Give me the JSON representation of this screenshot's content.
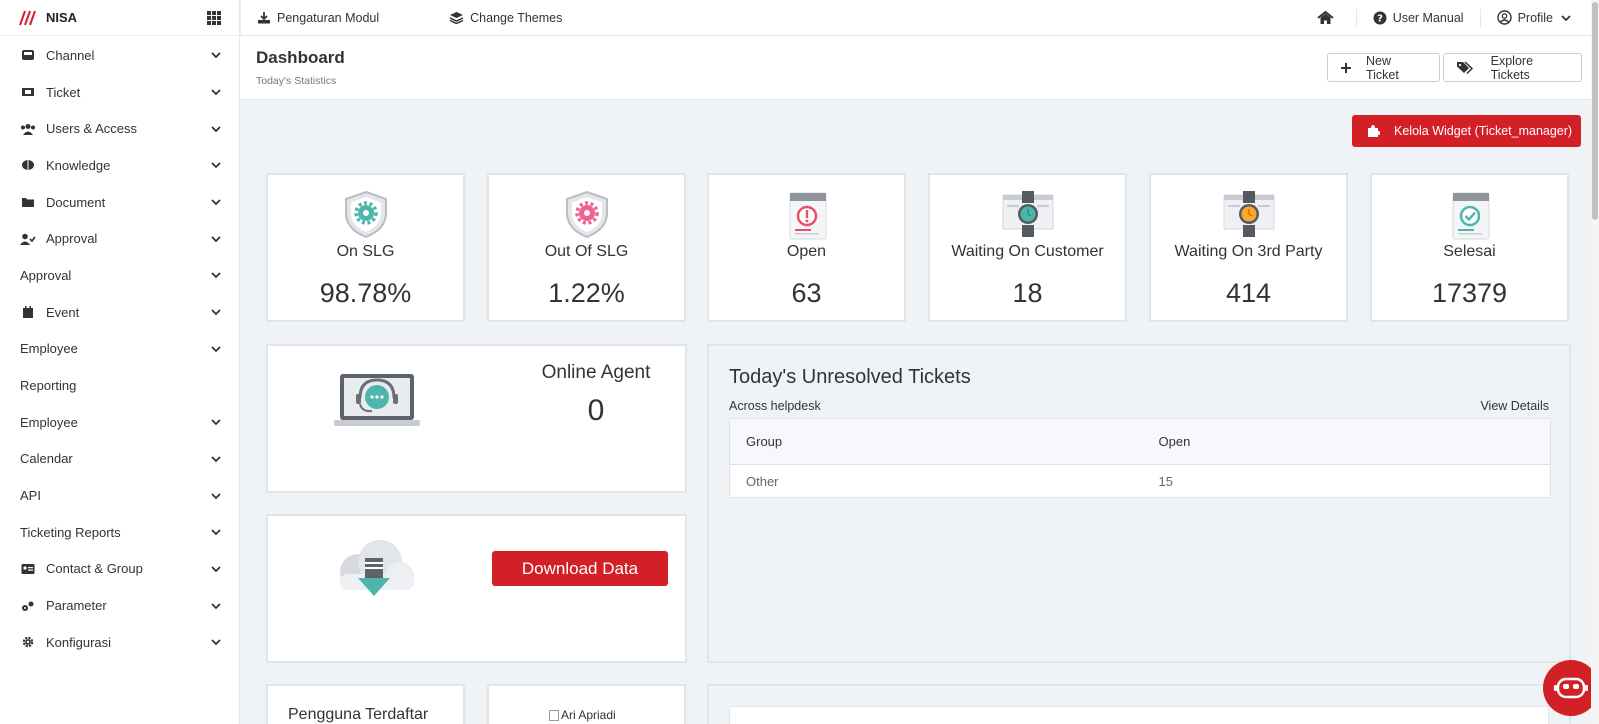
{
  "brand": {
    "name": "NISA",
    "logo": "nisa-logo",
    "apps_icon": "apps-grid-icon"
  },
  "sidebar": {
    "items": [
      {
        "label": "Channel",
        "icon": "channel-icon",
        "chevron": true
      },
      {
        "label": "Ticket",
        "icon": "ticket-icon",
        "chevron": true
      },
      {
        "label": "Users & Access",
        "icon": "users-icon",
        "chevron": true
      },
      {
        "label": "Knowledge",
        "icon": "brain-icon",
        "chevron": true
      },
      {
        "label": "Document",
        "icon": "folder-icon",
        "chevron": true
      },
      {
        "label": "Approval",
        "icon": "user-check-icon",
        "chevron": true
      },
      {
        "label": "Approval",
        "icon": "",
        "chevron": true
      },
      {
        "label": "Event",
        "icon": "calendar-icon",
        "chevron": true
      },
      {
        "label": "Employee",
        "icon": "",
        "chevron": true
      },
      {
        "label": "Reporting",
        "icon": "",
        "chevron": false
      },
      {
        "label": "Employee",
        "icon": "",
        "chevron": true
      },
      {
        "label": "Calendar",
        "icon": "",
        "chevron": true
      },
      {
        "label": "API",
        "icon": "",
        "chevron": true
      },
      {
        "label": "Ticketing Reports",
        "icon": "",
        "chevron": true
      },
      {
        "label": "Contact & Group",
        "icon": "address-card-icon",
        "chevron": true
      },
      {
        "label": "Parameter",
        "icon": "parameter-icon",
        "chevron": true
      },
      {
        "label": "Konfigurasi",
        "icon": "gear-icon",
        "chevron": true
      }
    ]
  },
  "topbar": {
    "module_settings": "Pengaturan Modul",
    "change_themes": "Change Themes",
    "user_manual": "User Manual",
    "profile": "Profile"
  },
  "header": {
    "title": "Dashboard",
    "subtitle": "Today's Statistics",
    "new_ticket": "New Ticket",
    "explore_tickets": "Explore Tickets"
  },
  "widget_button": "Kelola Widget (Ticket_manager)",
  "stats": [
    {
      "label": "On SLG",
      "value": "98.78%",
      "icon": "shield-gear-green-icon"
    },
    {
      "label": "Out Of SLG",
      "value": "1.22%",
      "icon": "shield-gear-pink-icon"
    },
    {
      "label": "Open",
      "value": "63",
      "icon": "document-alert-icon"
    },
    {
      "label": "Waiting On Customer",
      "value": "18",
      "icon": "watch-teal-icon"
    },
    {
      "label": "Waiting On 3rd Party",
      "value": "414",
      "icon": "watch-orange-icon"
    },
    {
      "label": "Selesai",
      "value": "17379",
      "icon": "document-check-icon"
    }
  ],
  "agent": {
    "label": "Online Agent",
    "value": "0",
    "icon": "support-laptop-icon"
  },
  "download": {
    "label": "Download Data",
    "icon": "cloud-download-icon"
  },
  "unresolved": {
    "title": "Today's Unresolved Tickets",
    "subtitle": "Across helpdesk",
    "view_details": "View Details",
    "columns": [
      "Group",
      "Open"
    ],
    "rows": [
      [
        "Other",
        "15"
      ]
    ]
  },
  "registered": {
    "label": "Pengguna Terdaftar"
  },
  "avatar": {
    "alt": "Ari Apriadi"
  },
  "colors": {
    "accent": "#d32027",
    "teal": "#4db6ac",
    "pink": "#f06292",
    "orange": "#ffa726"
  }
}
